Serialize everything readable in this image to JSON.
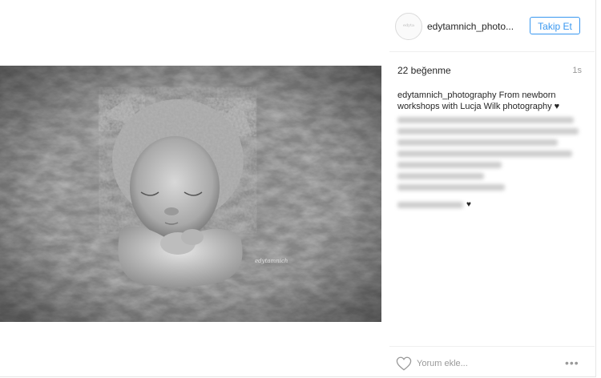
{
  "post": {
    "username": "edytamnich_photo...",
    "avatar_text": "edyta",
    "follow_label": "Takip Et",
    "likes": "22 beğenme",
    "time": "1s",
    "caption_username": "edytamnich_photography",
    "caption_text": "From newborn workshops with Lucja Wilk photography",
    "caption_heart": "♥",
    "comment_heart": "♥",
    "comment_placeholder": "Yorum ekle...",
    "more_label": "•••",
    "photo_watermark": "edytamnich"
  },
  "colors": {
    "accent": "#3897f0",
    "text": "#262626",
    "muted": "#999999"
  },
  "icons": {
    "like": "heart-outline-icon",
    "more": "ellipsis-icon"
  }
}
